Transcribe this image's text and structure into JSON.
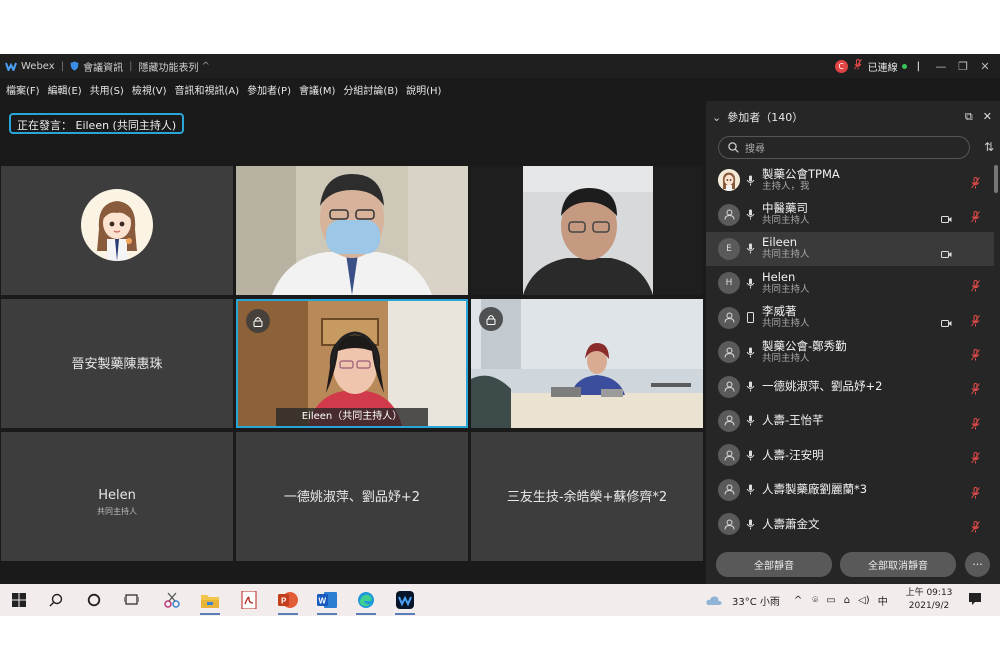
{
  "window": {
    "app_name": "Webex",
    "meeting_info": "會議資訊",
    "hide_menu": "隱藏功能表列",
    "rec_label": "C",
    "connection": "已連線",
    "min": "—",
    "restore": "❐",
    "close": "✕"
  },
  "menu": [
    "檔案(F)",
    "編輯(E)",
    "共用(S)",
    "檢視(V)",
    "音訊和視訊(A)",
    "參加者(P)",
    "會議(M)",
    "分組討論(B)",
    "說明(H)"
  ],
  "speaking": "正在發言： Eileen (共同主持人)",
  "tiles": [
    {
      "type": "avatar"
    },
    {
      "type": "video"
    },
    {
      "type": "video"
    },
    {
      "type": "name",
      "name": "晉安製藥陳惠珠"
    },
    {
      "type": "video",
      "label": "Eileen（共同主持人）"
    },
    {
      "type": "video"
    },
    {
      "type": "name",
      "name": "Helen",
      "sub": "共同主持人"
    },
    {
      "type": "name",
      "name": "一德姚淑萍、劉品妤+2"
    },
    {
      "type": "name",
      "name": "三友生技-余皓榮+蘇修齊*2"
    }
  ],
  "panel": {
    "title": "參加者（140）",
    "search_placeholder": "搜尋",
    "participants": [
      {
        "name": "製藥公會TPMA",
        "role": "主持人，我",
        "avatar": "tpma",
        "mic_muted": true,
        "camera": false
      },
      {
        "name": "中醫藥司",
        "role": "共同主持人",
        "avatar": "person",
        "mic_muted": true,
        "camera": true
      },
      {
        "name": "Eileen",
        "role": "共同主持人",
        "avatar": "E",
        "mic_muted": false,
        "camera": true,
        "selected": true
      },
      {
        "name": "Helen",
        "role": "共同主持人",
        "avatar": "H",
        "mic_muted": true,
        "camera": false
      },
      {
        "name": "李威著",
        "role": "共同主持人",
        "avatar": "person",
        "mic_muted": true,
        "camera": true,
        "phone": true
      },
      {
        "name": "製藥公會-鄭秀勤",
        "role": "共同主持人",
        "avatar": "person",
        "mic_muted": true,
        "camera": false
      },
      {
        "name": "一德姚淑萍、劉品妤+2",
        "role": "",
        "avatar": "person",
        "mic_muted": true,
        "camera": false
      },
      {
        "name": "人壽-王怡芊",
        "role": "",
        "avatar": "person",
        "mic_muted": true,
        "camera": false
      },
      {
        "name": "人壽-汪安明",
        "role": "",
        "avatar": "person",
        "mic_muted": true,
        "camera": false
      },
      {
        "name": "人壽製藥廠劉麗蘭*3",
        "role": "",
        "avatar": "person",
        "mic_muted": true,
        "camera": false
      },
      {
        "name": "人壽蕭金文",
        "role": "",
        "avatar": "person",
        "mic_muted": true,
        "camera": false
      }
    ],
    "mute_all": "全部靜音",
    "unmute_all": "全部取消靜音",
    "more": "···"
  },
  "taskbar": {
    "weather": "33°C 小雨",
    "ime": "中",
    "time": "上午 09:13",
    "date": "2021/9/2"
  },
  "colors": {
    "accent": "#2aa5d8",
    "muted_red": "#e24a4a",
    "online_green": "#3cc35b"
  }
}
